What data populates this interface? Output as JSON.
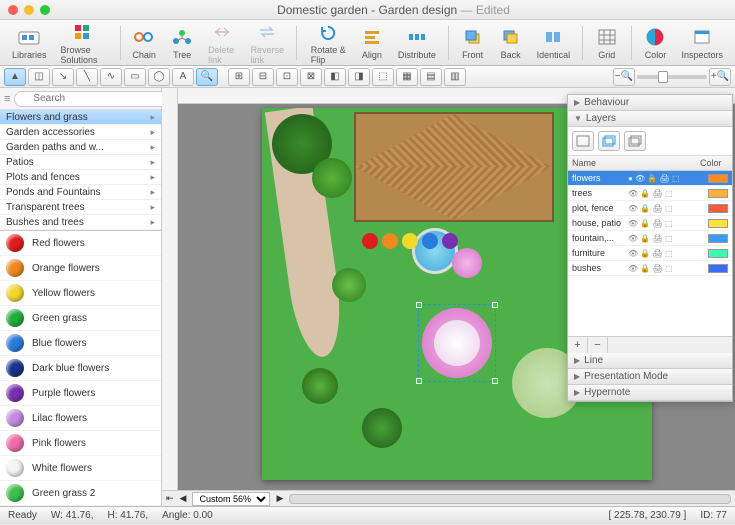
{
  "window": {
    "title_main": "Domestic garden - Garden design",
    "title_suffix": " — Edited"
  },
  "toolbar": {
    "libraries": "Libraries",
    "browse_solutions": "Browse Solutions",
    "chain": "Chain",
    "tree": "Tree",
    "delete_link": "Delete link",
    "reverse_link": "Reverse link",
    "rotate_flip": "Rotate & Flip",
    "align": "Align",
    "distribute": "Distribute",
    "front": "Front",
    "back": "Back",
    "identical": "Identical",
    "grid": "Grid",
    "color": "Color",
    "inspectors": "Inspectors"
  },
  "search": {
    "placeholder": "Search"
  },
  "categories": [
    {
      "label": "Flowers and grass",
      "selected": true
    },
    {
      "label": "Garden accessories"
    },
    {
      "label": "Garden paths and w..."
    },
    {
      "label": "Patios"
    },
    {
      "label": "Plots and fences"
    },
    {
      "label": "Ponds and Fountains"
    },
    {
      "label": "Transparent trees"
    },
    {
      "label": "Bushes and trees"
    }
  ],
  "shapes": [
    {
      "label": "Red flowers",
      "color": "#e21b1b"
    },
    {
      "label": "Orange flowers",
      "color": "#f08a1f"
    },
    {
      "label": "Yellow flowers",
      "color": "#f3d82a"
    },
    {
      "label": "Green grass",
      "color": "#1fae3a"
    },
    {
      "label": "Blue flowers",
      "color": "#2a7be0"
    },
    {
      "label": "Dark blue flowers",
      "color": "#16358c"
    },
    {
      "label": "Purple flowers",
      "color": "#7a2fb3"
    },
    {
      "label": "Lilac flowers",
      "color": "#c58adf"
    },
    {
      "label": "Pink flowers",
      "color": "#f06aa8"
    },
    {
      "label": "White flowers",
      "color": "#f4f4f4"
    },
    {
      "label": "Green grass 2",
      "color": "#3bc24d"
    }
  ],
  "inspector": {
    "behaviour": "Behaviour",
    "layers": "Layers",
    "line": "Line",
    "presentation": "Presentation Mode",
    "hypernote": "Hypernote",
    "head_name": "Name",
    "head_color": "Color",
    "rows": [
      {
        "name": "flowers",
        "color": "#ff8a1f",
        "selected": true
      },
      {
        "name": "trees",
        "color": "#ffb03a"
      },
      {
        "name": "plot, fence",
        "color": "#ff5a3a"
      },
      {
        "name": "house, patio",
        "color": "#ffe23a"
      },
      {
        "name": "fountain,...",
        "color": "#3a9bff"
      },
      {
        "name": "furniture",
        "color": "#3affb0"
      },
      {
        "name": "bushes",
        "color": "#3a6eff"
      }
    ]
  },
  "zoom": {
    "custom": "Custom 56%"
  },
  "status": {
    "ready": "Ready",
    "w": "W: 41.76,",
    "h": "H: 41.76,",
    "angle": "Angle: 0.00",
    "pos": "[ 225.78, 230.79 ]",
    "id": "ID: 77"
  }
}
